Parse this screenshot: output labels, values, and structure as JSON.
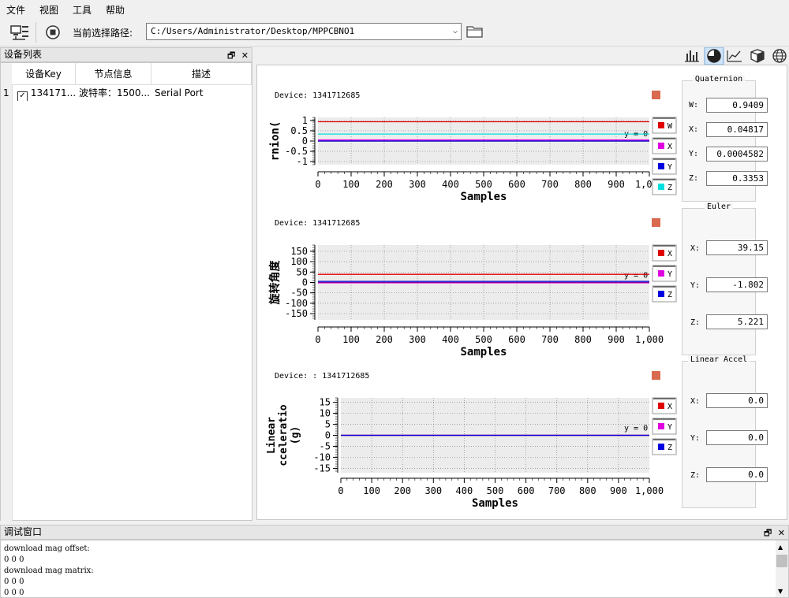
{
  "menu": [
    "文件",
    "视图",
    "工具",
    "帮助"
  ],
  "toolbar": {
    "path_label": "当前选择路径:",
    "path_value": "C:/Users/Administrator/Desktop/MPPCBNO1"
  },
  "device_panel": {
    "title": "设备列表",
    "columns": [
      "设备Key",
      "节点信息",
      "描述"
    ],
    "rows": [
      {
        "index": "1",
        "checked": true,
        "key": "134171...",
        "node": "波特率：1500...",
        "desc": "Serial Port"
      }
    ]
  },
  "quaternion": {
    "title": "Quaternion",
    "fields": [
      {
        "label": "W:",
        "value": "0.9409"
      },
      {
        "label": "X:",
        "value": "0.04817"
      },
      {
        "label": "Y:",
        "value": "0.0004582"
      },
      {
        "label": "Z:",
        "value": "0.3353"
      }
    ]
  },
  "euler": {
    "title": "Euler",
    "fields": [
      {
        "label": "X:",
        "value": "39.15"
      },
      {
        "label": "Y:",
        "value": "-1.802"
      },
      {
        "label": "Z:",
        "value": "5.221"
      }
    ]
  },
  "linear_accel": {
    "title": "Linear Accel",
    "fields": [
      {
        "label": "X:",
        "value": "0.0"
      },
      {
        "label": "Y:",
        "value": "0.0"
      },
      {
        "label": "Z:",
        "value": "0.0"
      }
    ]
  },
  "debug": {
    "title": "调试窗口",
    "lines": [
      "download mag offset:",
      "0 0 0",
      "download mag matrix:",
      "0 0 0",
      "0 0 0"
    ]
  },
  "colors": {
    "red": "#e00000",
    "magenta": "#e000e0",
    "blue": "#0000e0",
    "cyan": "#00e0e0",
    "device_square": "#d9694f"
  },
  "chart_data": [
    {
      "type": "line",
      "device": "Device: 1341712685",
      "ylabel": "rnion(",
      "xlabel": "Samples",
      "xlim": [
        0,
        1000
      ],
      "ylim": [
        -1.15,
        1.15
      ],
      "xticks": [
        "0",
        "100",
        "200",
        "300",
        "400",
        "500",
        "600",
        "700",
        "800",
        "900",
        "1,000"
      ],
      "yticks": [
        "1",
        "0.5",
        "0",
        "-0.5",
        "-1"
      ],
      "ytick_values": [
        1,
        0.5,
        0,
        -0.5,
        -1
      ],
      "zero_label": "y = 0",
      "series": [
        {
          "name": "W",
          "color": "#e00000",
          "value": 0.94
        },
        {
          "name": "X",
          "color": "#e000e0",
          "value": 0.05
        },
        {
          "name": "Y",
          "color": "#0000e0",
          "value": 0.0
        },
        {
          "name": "Z",
          "color": "#00e0e0",
          "value": 0.34
        }
      ]
    },
    {
      "type": "line",
      "device": "Device: 1341712685",
      "ylabel": "旋转角度",
      "xlabel": "Samples",
      "xlim": [
        0,
        1000
      ],
      "ylim": [
        -180,
        180
      ],
      "xticks": [
        "0",
        "100",
        "200",
        "300",
        "400",
        "500",
        "600",
        "700",
        "800",
        "900",
        "1,000"
      ],
      "yticks": [
        "150",
        "100",
        "50",
        "0",
        "-50",
        "-100",
        "-150"
      ],
      "ytick_values": [
        150,
        100,
        50,
        0,
        -50,
        -100,
        -150
      ],
      "zero_label": "y = 0",
      "series": [
        {
          "name": "X",
          "color": "#e00000",
          "value": 39.15
        },
        {
          "name": "Y",
          "color": "#e000e0",
          "value": -1.8
        },
        {
          "name": "Z",
          "color": "#0000e0",
          "value": 5.2
        }
      ]
    },
    {
      "type": "line",
      "device": "Device: : 1341712685",
      "ylabel": [
        "Linear",
        "cceleratio",
        "(g)"
      ],
      "xlabel": "Samples",
      "xlim": [
        0,
        1000
      ],
      "ylim": [
        -17,
        17
      ],
      "xticks": [
        "0",
        "100",
        "200",
        "300",
        "400",
        "500",
        "600",
        "700",
        "800",
        "900",
        "1,000"
      ],
      "yticks": [
        "15",
        "10",
        "5",
        "0",
        "-5",
        "-10",
        "-15"
      ],
      "ytick_values": [
        15,
        10,
        5,
        0,
        -5,
        -10,
        -15
      ],
      "zero_label": "y = 0",
      "series": [
        {
          "name": "X",
          "color": "#e00000",
          "value": 0.0
        },
        {
          "name": "Y",
          "color": "#e000e0",
          "value": 0.0
        },
        {
          "name": "Z",
          "color": "#0000e0",
          "value": 0.0
        }
      ]
    }
  ]
}
